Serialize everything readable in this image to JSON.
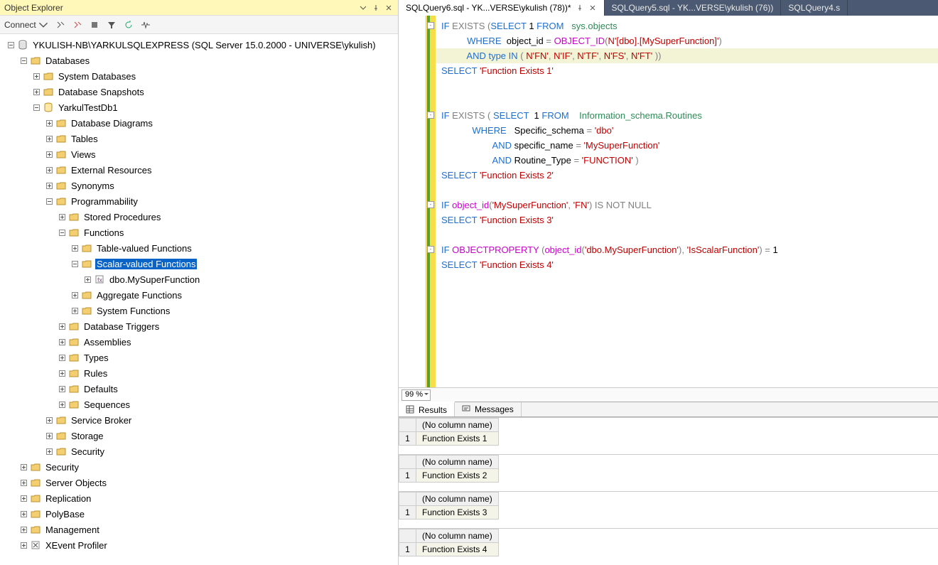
{
  "panel_title": "Object Explorer",
  "toolbar": {
    "connect": "Connect"
  },
  "tree": [
    {
      "d": 0,
      "e": "minus",
      "i": "server",
      "t": "YKULISH-NB\\YARKULSQLEXPRESS (SQL Server 15.0.2000 - UNIVERSE\\ykulish)"
    },
    {
      "d": 1,
      "e": "minus",
      "i": "folder",
      "t": "Databases"
    },
    {
      "d": 2,
      "e": "plus",
      "i": "folder",
      "t": "System Databases"
    },
    {
      "d": 2,
      "e": "plus",
      "i": "folder",
      "t": "Database Snapshots"
    },
    {
      "d": 2,
      "e": "minus",
      "i": "db",
      "t": "YarkulTestDb1"
    },
    {
      "d": 3,
      "e": "plus",
      "i": "folder",
      "t": "Database Diagrams"
    },
    {
      "d": 3,
      "e": "plus",
      "i": "folder",
      "t": "Tables"
    },
    {
      "d": 3,
      "e": "plus",
      "i": "folder",
      "t": "Views"
    },
    {
      "d": 3,
      "e": "plus",
      "i": "folder",
      "t": "External Resources"
    },
    {
      "d": 3,
      "e": "plus",
      "i": "folder",
      "t": "Synonyms"
    },
    {
      "d": 3,
      "e": "minus",
      "i": "folder",
      "t": "Programmability"
    },
    {
      "d": 4,
      "e": "plus",
      "i": "folder",
      "t": "Stored Procedures"
    },
    {
      "d": 4,
      "e": "minus",
      "i": "folder",
      "t": "Functions"
    },
    {
      "d": 5,
      "e": "plus",
      "i": "folder",
      "t": "Table-valued Functions"
    },
    {
      "d": 5,
      "e": "minus",
      "i": "folder",
      "t": "Scalar-valued Functions",
      "sel": true
    },
    {
      "d": 6,
      "e": "plus",
      "i": "func",
      "t": "dbo.MySuperFunction"
    },
    {
      "d": 5,
      "e": "plus",
      "i": "folder",
      "t": "Aggregate Functions"
    },
    {
      "d": 5,
      "e": "plus",
      "i": "folder",
      "t": "System Functions"
    },
    {
      "d": 4,
      "e": "plus",
      "i": "folder",
      "t": "Database Triggers"
    },
    {
      "d": 4,
      "e": "plus",
      "i": "folder",
      "t": "Assemblies"
    },
    {
      "d": 4,
      "e": "plus",
      "i": "folder",
      "t": "Types"
    },
    {
      "d": 4,
      "e": "plus",
      "i": "folder",
      "t": "Rules"
    },
    {
      "d": 4,
      "e": "plus",
      "i": "folder",
      "t": "Defaults"
    },
    {
      "d": 4,
      "e": "plus",
      "i": "folder",
      "t": "Sequences"
    },
    {
      "d": 3,
      "e": "plus",
      "i": "folder",
      "t": "Service Broker"
    },
    {
      "d": 3,
      "e": "plus",
      "i": "folder",
      "t": "Storage"
    },
    {
      "d": 3,
      "e": "plus",
      "i": "folder",
      "t": "Security"
    },
    {
      "d": 1,
      "e": "plus",
      "i": "folder",
      "t": "Security"
    },
    {
      "d": 1,
      "e": "plus",
      "i": "folder",
      "t": "Server Objects"
    },
    {
      "d": 1,
      "e": "plus",
      "i": "folder",
      "t": "Replication"
    },
    {
      "d": 1,
      "e": "plus",
      "i": "folder",
      "t": "PolyBase"
    },
    {
      "d": 1,
      "e": "plus",
      "i": "folder",
      "t": "Management"
    },
    {
      "d": 1,
      "e": "plus",
      "i": "xe",
      "t": "XEvent Profiler"
    }
  ],
  "doc_tabs": [
    {
      "t": "SQLQuery6.sql - YK...VERSE\\ykulish (78))*",
      "active": true,
      "pin": true,
      "close": true
    },
    {
      "t": "SQLQuery5.sql - YK...VERSE\\ykulish (76))",
      "active": false
    },
    {
      "t": "SQLQuery4.s",
      "active": false
    }
  ],
  "zoom": "99 %",
  "code_lines": [
    [
      [
        "kw",
        "IF "
      ],
      [
        "gr",
        "EXISTS "
      ],
      [
        "op",
        "("
      ],
      [
        "kw",
        "SELECT "
      ],
      [
        "id",
        "1 "
      ],
      [
        "kw",
        "FROM   "
      ],
      [
        "sy",
        "sys"
      ],
      [
        "op",
        "."
      ],
      [
        "sy",
        "objects"
      ]
    ],
    [
      [
        "id",
        "          "
      ],
      [
        "kw",
        "WHERE  "
      ],
      [
        "id",
        "object_id "
      ],
      [
        "op",
        "= "
      ],
      [
        "fn",
        "OBJECT_ID"
      ],
      [
        "op",
        "("
      ],
      [
        "str",
        "N'[dbo].[MySuperFunction]'"
      ],
      [
        "op",
        ")"
      ]
    ],
    [
      [
        "id",
        "          "
      ],
      [
        "kw",
        "AND "
      ],
      [
        "kw",
        "type "
      ],
      [
        "kw",
        "IN "
      ],
      [
        "op",
        "( "
      ],
      [
        "str",
        "N'FN'"
      ],
      [
        "op",
        ", "
      ],
      [
        "str",
        "N'IF'"
      ],
      [
        "op",
        ", "
      ],
      [
        "str",
        "N'TF'"
      ],
      [
        "op",
        ", "
      ],
      [
        "str",
        "N'FS'"
      ],
      [
        "op",
        ", "
      ],
      [
        "str",
        "N'FT'"
      ],
      [
        "op",
        " ))"
      ]
    ],
    [
      [
        "kw",
        "SELECT "
      ],
      [
        "str",
        "'Function Exists 1'"
      ]
    ],
    [],
    [],
    [
      [
        "kw",
        "IF "
      ],
      [
        "gr",
        "EXISTS "
      ],
      [
        "op",
        "( "
      ],
      [
        "kw",
        "SELECT  "
      ],
      [
        "id",
        "1 "
      ],
      [
        "kw",
        "FROM    "
      ],
      [
        "sy",
        "Information_schema"
      ],
      [
        "op",
        "."
      ],
      [
        "sy",
        "Routines"
      ]
    ],
    [
      [
        "id",
        "            "
      ],
      [
        "kw",
        "WHERE   "
      ],
      [
        "id",
        "Specific_schema "
      ],
      [
        "op",
        "= "
      ],
      [
        "str",
        "'dbo'"
      ]
    ],
    [
      [
        "id",
        "                    "
      ],
      [
        "kw",
        "AND "
      ],
      [
        "id",
        "specific_name "
      ],
      [
        "op",
        "= "
      ],
      [
        "str",
        "'MySuperFunction'"
      ]
    ],
    [
      [
        "id",
        "                    "
      ],
      [
        "kw",
        "AND "
      ],
      [
        "id",
        "Routine_Type "
      ],
      [
        "op",
        "= "
      ],
      [
        "str",
        "'FUNCTION'"
      ],
      [
        "op",
        " )"
      ]
    ],
    [
      [
        "kw",
        "SELECT "
      ],
      [
        "str",
        "'Function Exists 2'"
      ]
    ],
    [],
    [
      [
        "kw",
        "IF "
      ],
      [
        "fn",
        "object_id"
      ],
      [
        "op",
        "("
      ],
      [
        "str",
        "'MySuperFunction'"
      ],
      [
        "op",
        ", "
      ],
      [
        "str",
        "'FN'"
      ],
      [
        "op",
        ") "
      ],
      [
        "gr",
        "IS NOT NULL"
      ]
    ],
    [
      [
        "kw",
        "SELECT "
      ],
      [
        "str",
        "'Function Exists 3'"
      ]
    ],
    [],
    [
      [
        "kw",
        "IF "
      ],
      [
        "fn",
        "OBJECTPROPERTY "
      ],
      [
        "op",
        "("
      ],
      [
        "fn",
        "object_id"
      ],
      [
        "op",
        "("
      ],
      [
        "str",
        "'dbo.MySuperFunction'"
      ],
      [
        "op",
        "), "
      ],
      [
        "str",
        "'IsScalarFunction'"
      ],
      [
        "op",
        ") = "
      ],
      [
        "id",
        "1"
      ]
    ],
    [
      [
        "kw",
        "SELECT "
      ],
      [
        "str",
        "'Function Exists 4'"
      ]
    ]
  ],
  "highlight_line_index": 2,
  "fold_lines": [
    0,
    6,
    12,
    15
  ],
  "result_tabs": {
    "results": "Results",
    "messages": "Messages"
  },
  "no_col": "(No column name)",
  "results": [
    {
      "rn": "1",
      "v": "Function Exists 1"
    },
    {
      "rn": "1",
      "v": "Function Exists 2"
    },
    {
      "rn": "1",
      "v": "Function Exists 3"
    },
    {
      "rn": "1",
      "v": "Function Exists 4"
    }
  ]
}
